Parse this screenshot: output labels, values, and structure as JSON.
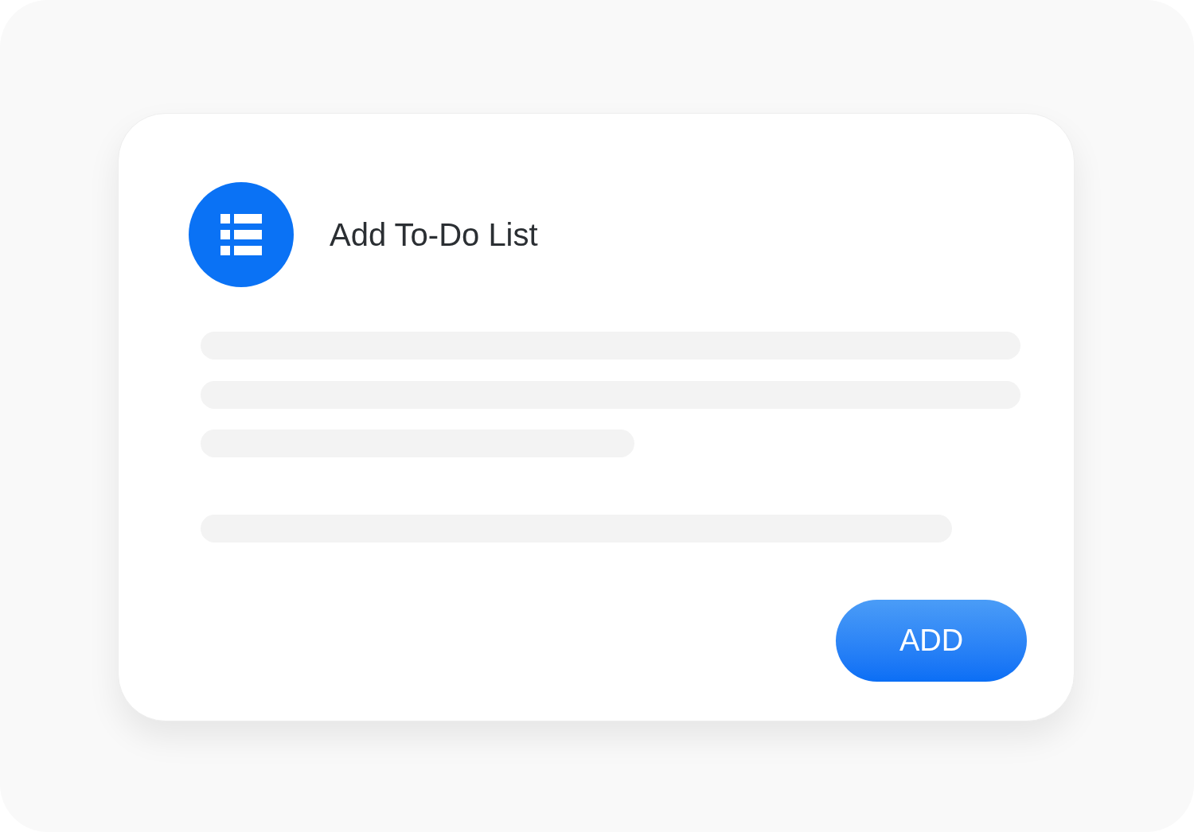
{
  "dialog": {
    "title": "Add To-Do List",
    "button": "ADD"
  }
}
